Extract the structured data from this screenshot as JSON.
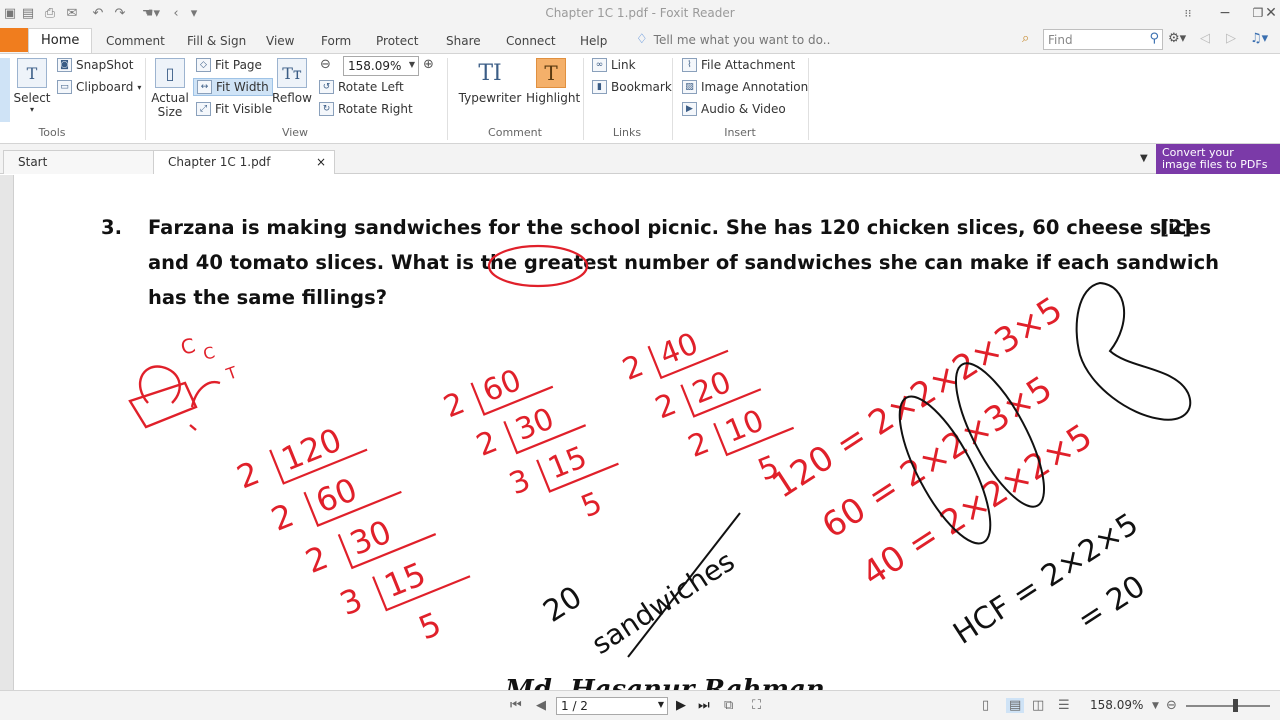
{
  "window": {
    "title": "Chapter 1C 1.pdf - Foxit Reader",
    "min": "−",
    "max": "❐",
    "close": "✕"
  },
  "tabs": {
    "file_label": "",
    "items": [
      "Home",
      "Comment",
      "Fill & Sign",
      "View",
      "Form",
      "Protect",
      "Share",
      "Connect",
      "Help"
    ],
    "tell_me": "Tell me what you want to do..",
    "find_placeholder": "Find"
  },
  "ribbon": {
    "tools": {
      "select": "Select",
      "snapshot": "SnapShot",
      "clipboard": "Clipboard",
      "label": "Tools"
    },
    "view": {
      "actual_size_1": "Actual",
      "actual_size_2": "Size",
      "fit_page": "Fit Page",
      "fit_width": "Fit Width",
      "fit_visible": "Fit Visible",
      "reflow": "Reflow",
      "zoom": "158.09%",
      "rotate_left": "Rotate Left",
      "rotate_right": "Rotate Right",
      "label": "View"
    },
    "comment": {
      "typewriter": "Typewriter",
      "highlight": "Highlight",
      "label": "Comment"
    },
    "links": {
      "link": "Link",
      "bookmark": "Bookmark",
      "label": "Links"
    },
    "insert": {
      "file_attachment": "File Attachment",
      "image_annotation": "Image Annotation",
      "audio_video": "Audio & Video",
      "label": "Insert"
    }
  },
  "doctabs": {
    "start": "Start",
    "file": "Chapter 1C 1.pdf",
    "close": "×"
  },
  "banner": {
    "line1": "Convert your",
    "line2": "image files to PDFs"
  },
  "document": {
    "number": "3.",
    "marks": "[2]",
    "line1": "Farzana is making sandwiches for the school picnic. She has 120 chicken slices, 60 cheese slices",
    "line2": "and 40 tomato slices. What is the greatest number of sandwiches she can make if each sandwich",
    "line3": "has the same fillings?",
    "signature": "Md. Hasanur Rahman",
    "annotations": {
      "venn_c1": "C",
      "venn_c2": "C",
      "venn_t": "T",
      "div120": [
        "2",
        "120",
        "2",
        "60",
        "2",
        "30",
        "3",
        "15",
        "5"
      ],
      "div60": [
        "2",
        "60",
        "2",
        "30",
        "3",
        "15",
        "5"
      ],
      "div40": [
        "2",
        "40",
        "2",
        "20",
        "2",
        "10",
        "5"
      ],
      "eq120": "120 = 2×2×2×3×5",
      "eq60": "60 = 2×2×3×5",
      "eq40": "40 = 2×2×2×5",
      "hcf": "HCF = 2×2×5",
      "hcf_result": "= 20",
      "answer_num": "20",
      "answer_word": "sandwiches"
    }
  },
  "status": {
    "page": "1 / 2",
    "zoom": "158.09%"
  },
  "colors": {
    "ink_red": "#e0202a",
    "ink_black": "#111111",
    "file_tab": "#f07d1e",
    "banner": "#7b3aa8"
  }
}
